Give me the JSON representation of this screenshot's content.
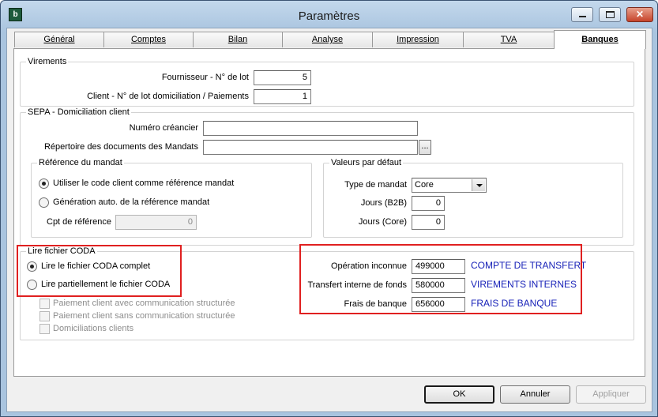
{
  "window": {
    "title": "Paramètres",
    "app_icon": "b",
    "minimize_icon": "minimize-icon",
    "maximize_icon": "maximize-icon",
    "close_icon": "close-icon"
  },
  "tabs": [
    "Général",
    "Comptes",
    "Bilan",
    "Analyse",
    "Impression",
    "TVA",
    "Banques"
  ],
  "active_tab": "Banques",
  "virements": {
    "legend": "Virements",
    "fournisseur_label": "Fournisseur - N° de lot",
    "fournisseur_value": "5",
    "client_label": "Client - N° de lot domiciliation / Paiements",
    "client_value": "1"
  },
  "sepa": {
    "legend": "SEPA - Domiciliation client",
    "numero_creancier_label": "Numéro créancier",
    "numero_creancier_value": "",
    "repertoire_label": "Répertoire des documents des Mandats",
    "repertoire_value": "",
    "browse_label": "...",
    "reference": {
      "legend": "Référence du mandat",
      "option1": "Utiliser le code client comme référence mandat",
      "option2": "Génération auto. de la référence mandat",
      "cpt_label": "Cpt de référence",
      "cpt_value": "0"
    },
    "defaults": {
      "legend": "Valeurs par défaut",
      "type_label": "Type de mandat",
      "type_value": "Core",
      "b2b_label": "Jours (B2B)",
      "b2b_value": "0",
      "core_label": "Jours (Core)",
      "core_value": "0"
    }
  },
  "coda": {
    "legend": "Lire fichier CODA",
    "option_full": "Lire le fichier CODA complet",
    "option_partial": "Lire partiellement le fichier CODA",
    "check1": "Paiement client avec communication structurée",
    "check2": "Paiement client sans communication structurée",
    "check3": "Domiciliations clients",
    "op_inconnue_label": "Opération inconnue",
    "op_inconnue_value": "499000",
    "op_inconnue_name": "COMPTE DE TRANSFERT",
    "transfert_label": "Transfert interne de fonds",
    "transfert_value": "580000",
    "transfert_name": "VIREMENTS INTERNES",
    "frais_label": "Frais de banque",
    "frais_value": "656000",
    "frais_name": "FRAIS DE BANQUE"
  },
  "buttons": {
    "ok": "OK",
    "cancel": "Annuler",
    "apply": "Appliquer"
  },
  "colors": {
    "highlight_box": "#e02020",
    "account_name": "#1822b8"
  }
}
